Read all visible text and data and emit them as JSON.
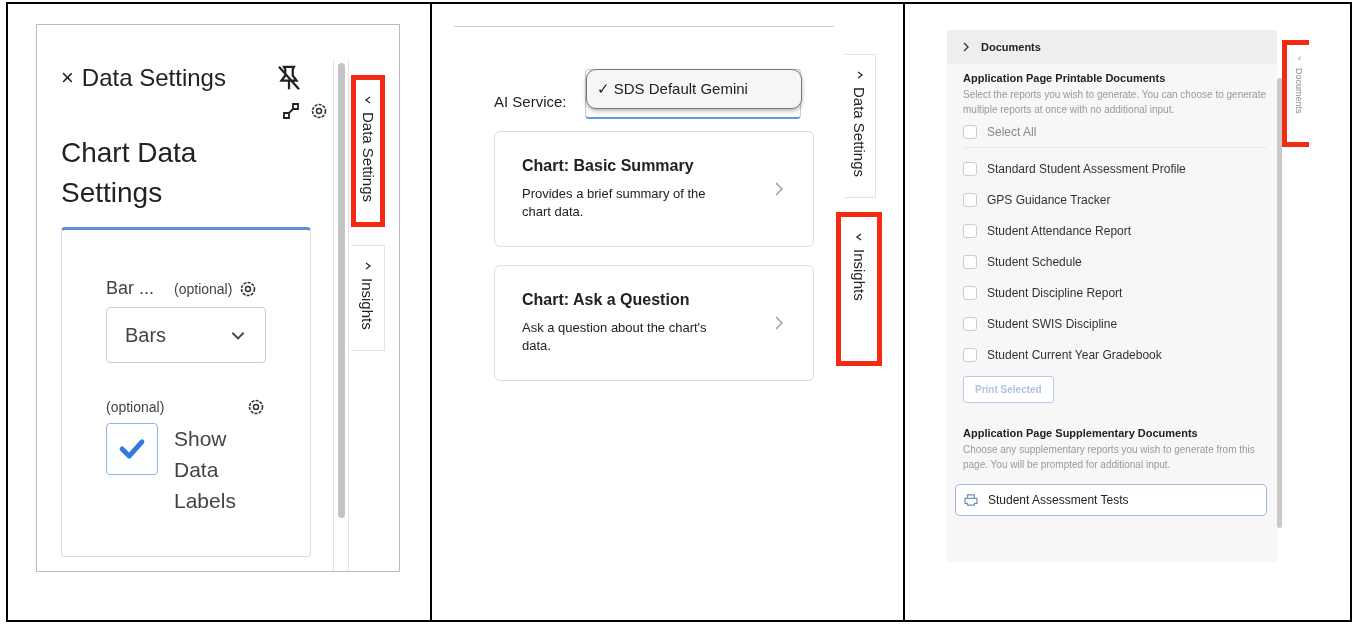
{
  "panels": [
    {
      "kind": "data_settings",
      "close": "×",
      "title": "Data Settings",
      "heading": "Chart Data Settings",
      "bar_field": {
        "label": "Bar ...",
        "hint": "(optional)",
        "value": "Bars"
      },
      "labels_field": {
        "hint": "(optional)",
        "label": "Show Data Labels",
        "checked": true
      },
      "side_tabs": [
        {
          "label": "Data Settings",
          "selected": true,
          "highlighted": true
        },
        {
          "label": "Insights",
          "selected": false,
          "highlighted": false
        }
      ]
    },
    {
      "kind": "insights",
      "service_label": "AI Service:",
      "service_option": "✓ SDS Default Gemini",
      "cards": [
        {
          "title": "Chart: Basic Summary",
          "text": "Provides a brief summary of the chart data."
        },
        {
          "title": "Chart: Ask a Question",
          "text": "Ask a question about the chart's data."
        }
      ],
      "side_tabs": [
        {
          "label": "Data Settings",
          "selected": false,
          "highlighted": false
        },
        {
          "label": "Insights",
          "selected": true,
          "highlighted": true
        }
      ]
    },
    {
      "kind": "documents",
      "section": "Documents",
      "printable": {
        "title": "Application Page Printable Documents",
        "text": "Select the reports you wish to generate. You can choose to generate multiple reports at once with no additional input.",
        "select_all": {
          "label": "Select All",
          "checked": false
        },
        "items": [
          {
            "label": "Standard Student Assessment Profile",
            "checked": false
          },
          {
            "label": "GPS Guidance Tracker",
            "checked": false
          },
          {
            "label": "Student Attendance Report",
            "checked": false
          },
          {
            "label": "Student Schedule",
            "checked": false
          },
          {
            "label": "Student Discipline Report",
            "checked": false
          },
          {
            "label": "Student SWIS Discipline",
            "checked": false
          },
          {
            "label": "Student Current Year Gradebook",
            "checked": false
          }
        ],
        "button": {
          "label": "Print Selected",
          "disabled": true
        }
      },
      "supplementary": {
        "title": "Application Page Supplementary Documents",
        "text": "Choose any supplementary reports you wish to generate from this page. You will be prompted for additional input.",
        "item": "Student Assessment Tests"
      },
      "side_tabs": [
        {
          "label": "Documents",
          "selected": true,
          "highlighted": true
        }
      ]
    }
  ]
}
